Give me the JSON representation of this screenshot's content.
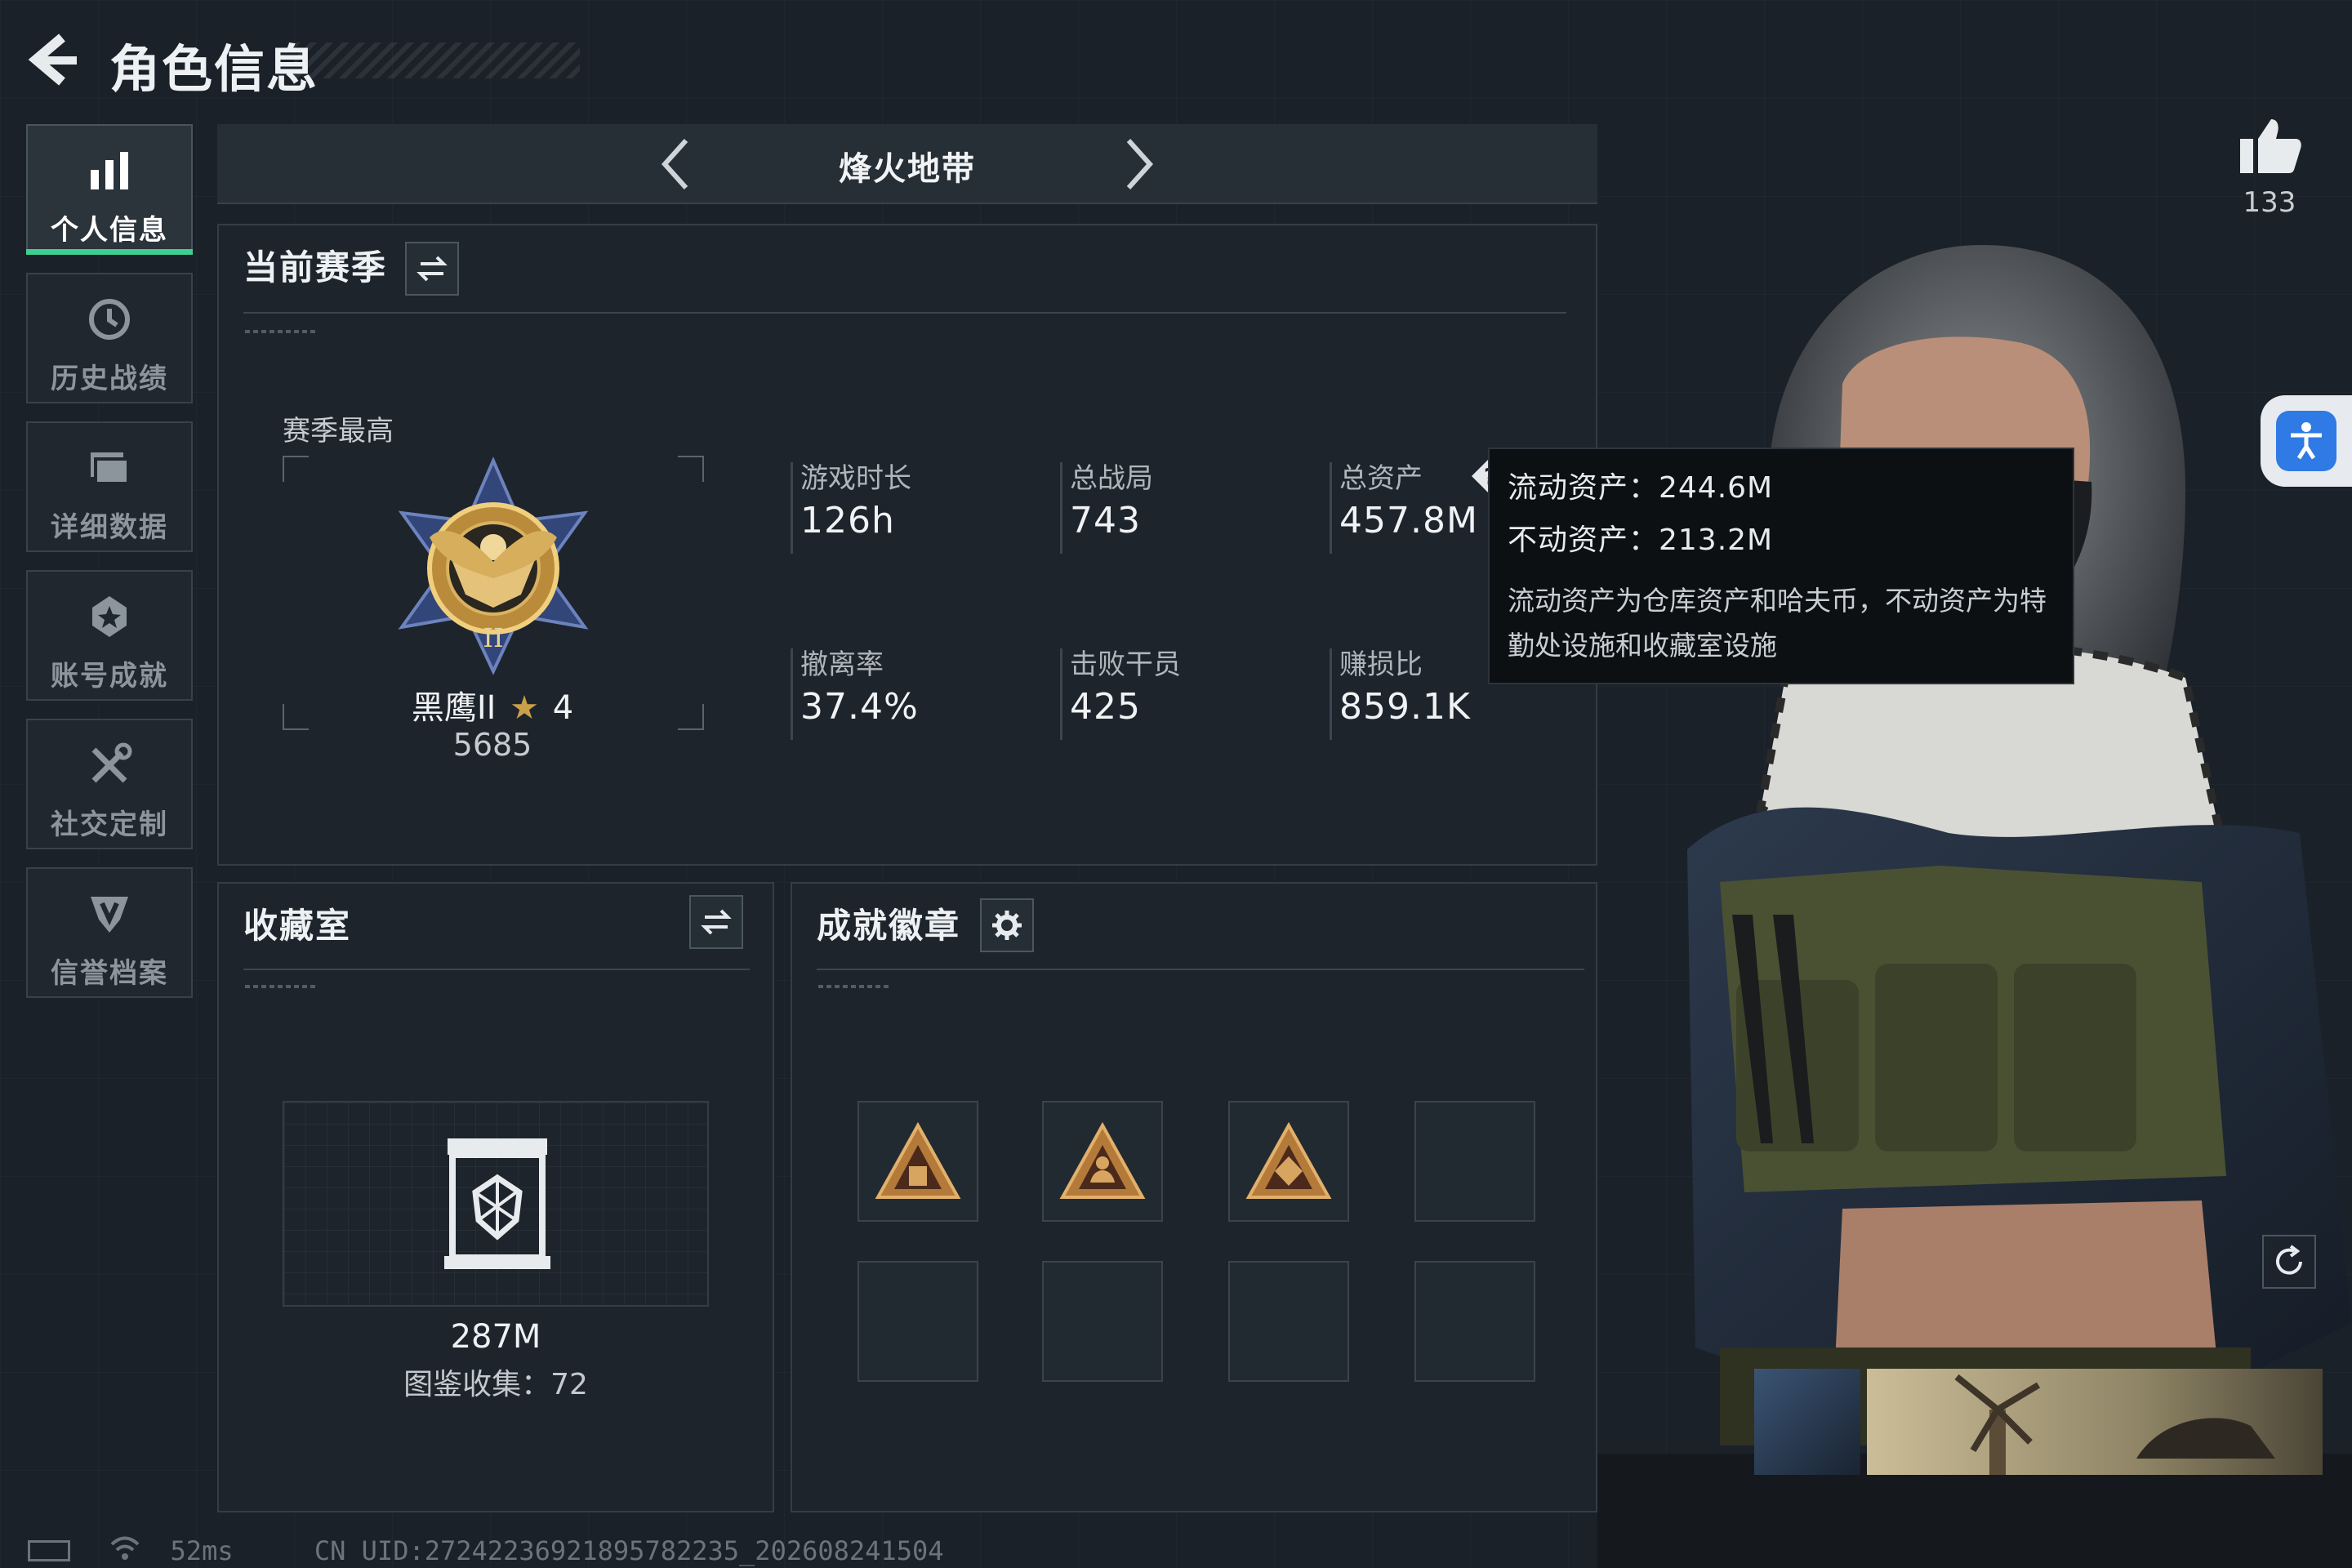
{
  "header": {
    "title": "角色信息"
  },
  "sidebar": {
    "items": [
      {
        "label": "个人信息",
        "icon": "bar-chart-icon",
        "active": true
      },
      {
        "label": "历史战绩",
        "icon": "history-clock-icon",
        "active": false
      },
      {
        "label": "详细数据",
        "icon": "folder-icon",
        "active": false
      },
      {
        "label": "账号成就",
        "icon": "achievement-icon",
        "active": false
      },
      {
        "label": "社交定制",
        "icon": "tools-icon",
        "active": false
      },
      {
        "label": "信誉档案",
        "icon": "credit-shield-icon",
        "active": false
      }
    ]
  },
  "mode": {
    "title": "烽火地带"
  },
  "season": {
    "title": "当前赛季",
    "best_label": "赛季最高",
    "rank_name": "黑鹰II",
    "rank_stars": "4",
    "rank_score": "5685",
    "stats": [
      {
        "label": "游戏时长",
        "value": "126h"
      },
      {
        "label": "总战局",
        "value": "743"
      },
      {
        "label": "总资产",
        "value": "457.8M"
      },
      {
        "label": "撤离率",
        "value": "37.4%"
      },
      {
        "label": "击败干员",
        "value": "425"
      },
      {
        "label": "赚损比",
        "value": "859.1K"
      }
    ]
  },
  "tooltip": {
    "liquid": "流动资产：244.6M",
    "fixed": "不动资产：213.2M",
    "note": "流动资产为仓库资产和哈夫币，不动资产为特勤处设施和收藏室设施"
  },
  "collection": {
    "title": "收藏室",
    "value": "287M",
    "count": "图鉴收集：72"
  },
  "badges": {
    "title": "成就徽章",
    "filled": 3,
    "total": 8
  },
  "likes": {
    "count": "133"
  },
  "status": {
    "ping": "52ms",
    "uid": "CN UID:272422369218957822​35_202608241504"
  },
  "colors": {
    "accent": "#3fce92",
    "gold": "#c9a04a",
    "panel": "#1e252c"
  }
}
